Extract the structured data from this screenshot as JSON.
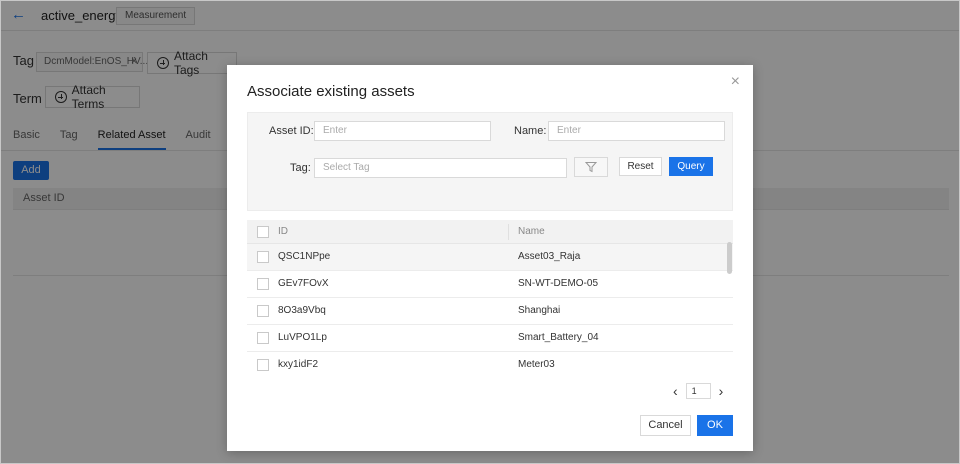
{
  "header": {
    "title": "active_energy",
    "badge": "Measurement"
  },
  "tag_row": {
    "label": "Tag",
    "chip": "DcmModel:EnOS_HV...",
    "chip_close": "×",
    "attach_label": "Attach Tags"
  },
  "term_row": {
    "label": "Term",
    "attach_label": "Attach Terms"
  },
  "tabs": [
    {
      "label": "Basic"
    },
    {
      "label": "Tag"
    },
    {
      "label": "Related Asset"
    },
    {
      "label": "Audit"
    }
  ],
  "add_label": "Add",
  "bg_table": {
    "column_asset_id": "Asset ID"
  },
  "modal": {
    "title": "Associate existing assets",
    "close": "×",
    "filters": {
      "asset_id_label": "Asset ID:",
      "asset_id_placeholder": "Enter",
      "name_label": "Name:",
      "name_placeholder": "Enter",
      "tag_label": "Tag:",
      "tag_placeholder": "Select Tag",
      "reset_label": "Reset",
      "query_label": "Query"
    },
    "table": {
      "col_id": "ID",
      "col_name": "Name",
      "rows": [
        {
          "id": "QSC1NPpe",
          "name": "Asset03_Raja"
        },
        {
          "id": "GEv7FOvX",
          "name": "SN-WT-DEMO-05"
        },
        {
          "id": "8O3a9Vbq",
          "name": "Shanghai"
        },
        {
          "id": "LuVPO1Lp",
          "name": "Smart_Battery_04"
        },
        {
          "id": "kxy1idF2",
          "name": "Meter03"
        }
      ]
    },
    "pagination": {
      "page": "1",
      "prev": "‹",
      "next": "›"
    },
    "cancel_label": "Cancel",
    "ok_label": "OK"
  },
  "colors": {
    "accent": "#1a73e8",
    "overlay": "rgba(0,0,0,0.45)"
  }
}
